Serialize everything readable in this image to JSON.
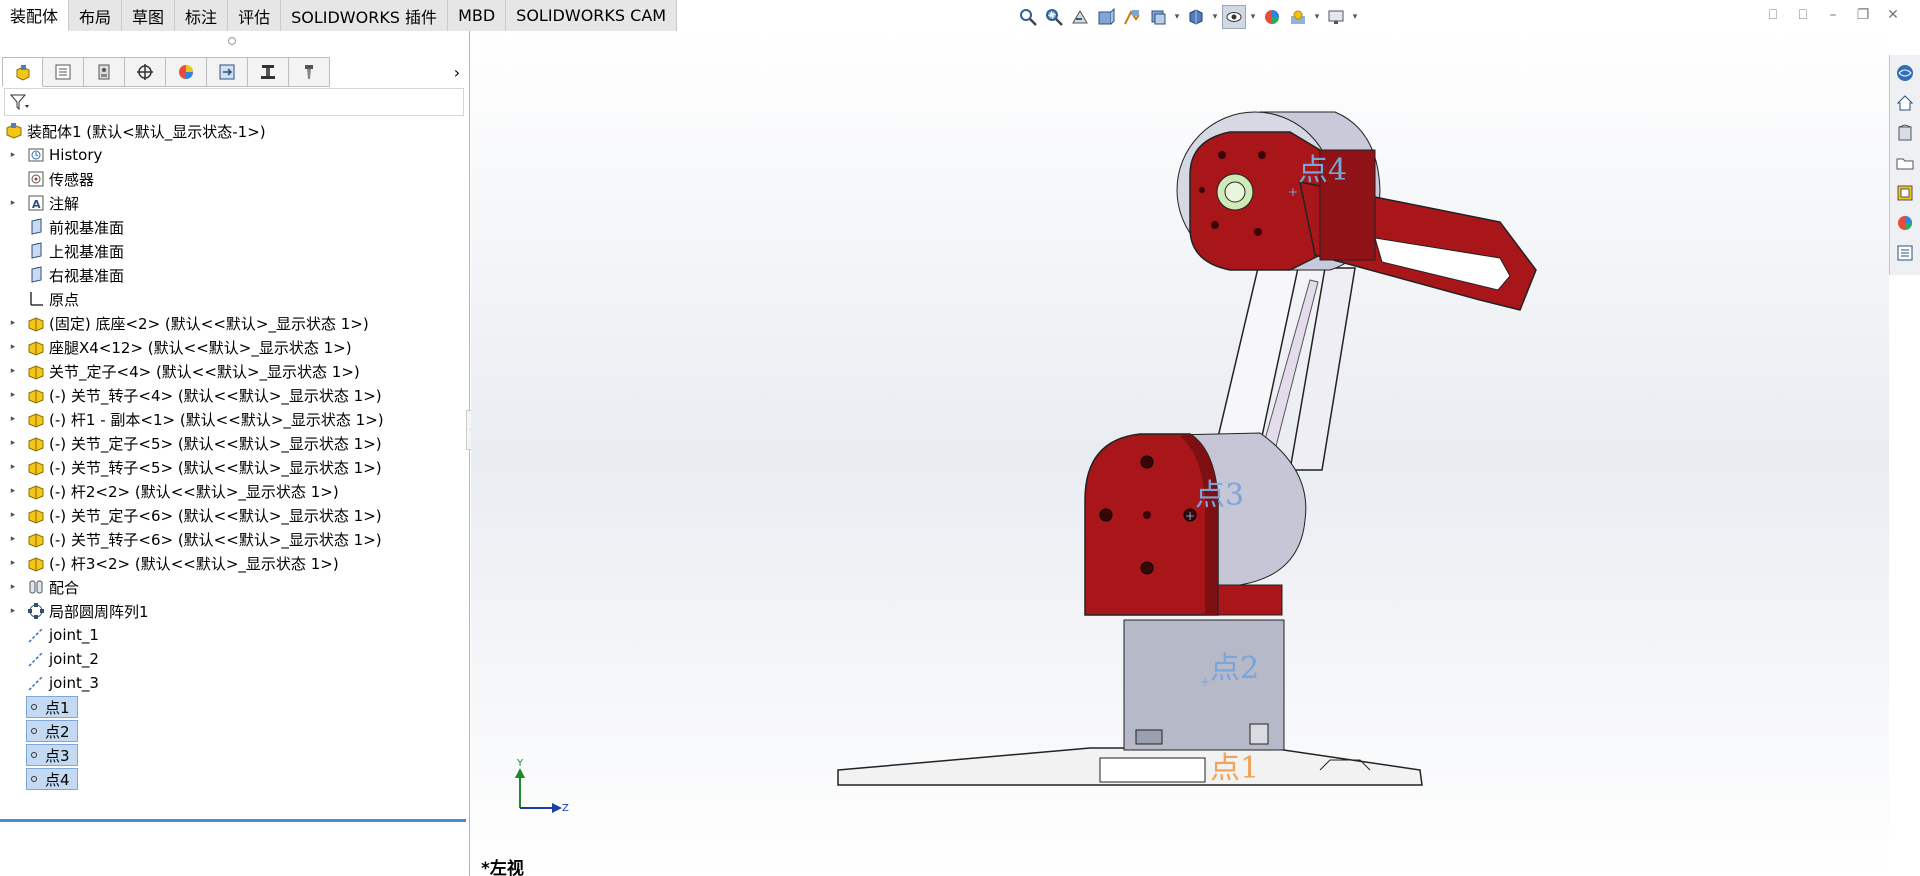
{
  "ribbon": {
    "tabs": [
      {
        "label": "装配体",
        "active": true
      },
      {
        "label": "布局"
      },
      {
        "label": "草图"
      },
      {
        "label": "标注"
      },
      {
        "label": "评估"
      },
      {
        "label": "SOLIDWORKS 插件"
      },
      {
        "label": "MBD"
      },
      {
        "label": "SOLIDWORKS CAM"
      }
    ]
  },
  "heads_up_toolbar": {
    "icons": [
      "zoom-to-fit-icon",
      "zoom-area-icon",
      "previous-view-icon",
      "section-view-icon",
      "dynamic-annotation-icon",
      "view-orientation-icon",
      "display-style-icon",
      "hide-show-items-icon",
      "edit-appearance-icon",
      "apply-scene-icon",
      "view-settings-icon"
    ]
  },
  "feature_tree": {
    "root": "装配体1 (默认<默认_显示状态-1>)",
    "items": [
      {
        "label": "History",
        "icon": "history-folder-icon",
        "expand": true
      },
      {
        "label": "传感器",
        "icon": "sensor-icon",
        "expand": false
      },
      {
        "label": "注解",
        "icon": "annotation-icon",
        "expand": true
      },
      {
        "label": "前视基准面",
        "icon": "plane-icon",
        "expand": false
      },
      {
        "label": "上视基准面",
        "icon": "plane-icon",
        "expand": false
      },
      {
        "label": "右视基准面",
        "icon": "plane-icon",
        "expand": false
      },
      {
        "label": "原点",
        "icon": "origin-icon",
        "expand": false
      },
      {
        "label": "(固定) 底座<2> (默认<<默认>_显示状态 1>)",
        "icon": "part-icon",
        "expand": true
      },
      {
        "label": "座腿X4<12> (默认<<默认>_显示状态 1>)",
        "icon": "part-icon",
        "expand": true
      },
      {
        "label": "关节_定子<4> (默认<<默认>_显示状态 1>)",
        "icon": "part-icon",
        "expand": true
      },
      {
        "label": "(-) 关节_转子<4> (默认<<默认>_显示状态 1>)",
        "icon": "part-icon",
        "expand": true
      },
      {
        "label": "(-) 杆1 - 副本<1> (默认<<默认>_显示状态 1>)",
        "icon": "part-icon",
        "expand": true
      },
      {
        "label": "(-) 关节_定子<5> (默认<<默认>_显示状态 1>)",
        "icon": "part-icon",
        "expand": true
      },
      {
        "label": "(-) 关节_转子<5> (默认<<默认>_显示状态 1>)",
        "icon": "part-icon",
        "expand": true
      },
      {
        "label": "(-) 杆2<2> (默认<<默认>_显示状态 1>)",
        "icon": "part-icon",
        "expand": true
      },
      {
        "label": "(-) 关节_定子<6> (默认<<默认>_显示状态 1>)",
        "icon": "part-icon",
        "expand": true
      },
      {
        "label": "(-) 关节_转子<6> (默认<<默认>_显示状态 1>)",
        "icon": "part-icon",
        "expand": true
      },
      {
        "label": "(-) 杆3<2> (默认<<默认>_显示状态 1>)",
        "icon": "part-icon",
        "expand": true
      },
      {
        "label": "配合",
        "icon": "mates-icon",
        "expand": true
      },
      {
        "label": "局部圆周阵列1",
        "icon": "circular-pattern-icon",
        "expand": true
      },
      {
        "label": "joint_1",
        "icon": "axis-icon",
        "expand": false
      },
      {
        "label": "joint_2",
        "icon": "axis-icon",
        "expand": false
      },
      {
        "label": "joint_3",
        "icon": "axis-icon",
        "expand": false
      }
    ],
    "points": [
      "点1",
      "点2",
      "点3",
      "点4"
    ]
  },
  "viewport": {
    "view_name": "*左视",
    "point_labels": [
      "点1",
      "点2",
      "点3",
      "点4"
    ],
    "triad": {
      "y": "Y",
      "z": "Z"
    }
  },
  "colors": {
    "part_red": "#a8161a",
    "part_gray": "#b9bccb",
    "accent_blue": "#4a8bd1"
  }
}
